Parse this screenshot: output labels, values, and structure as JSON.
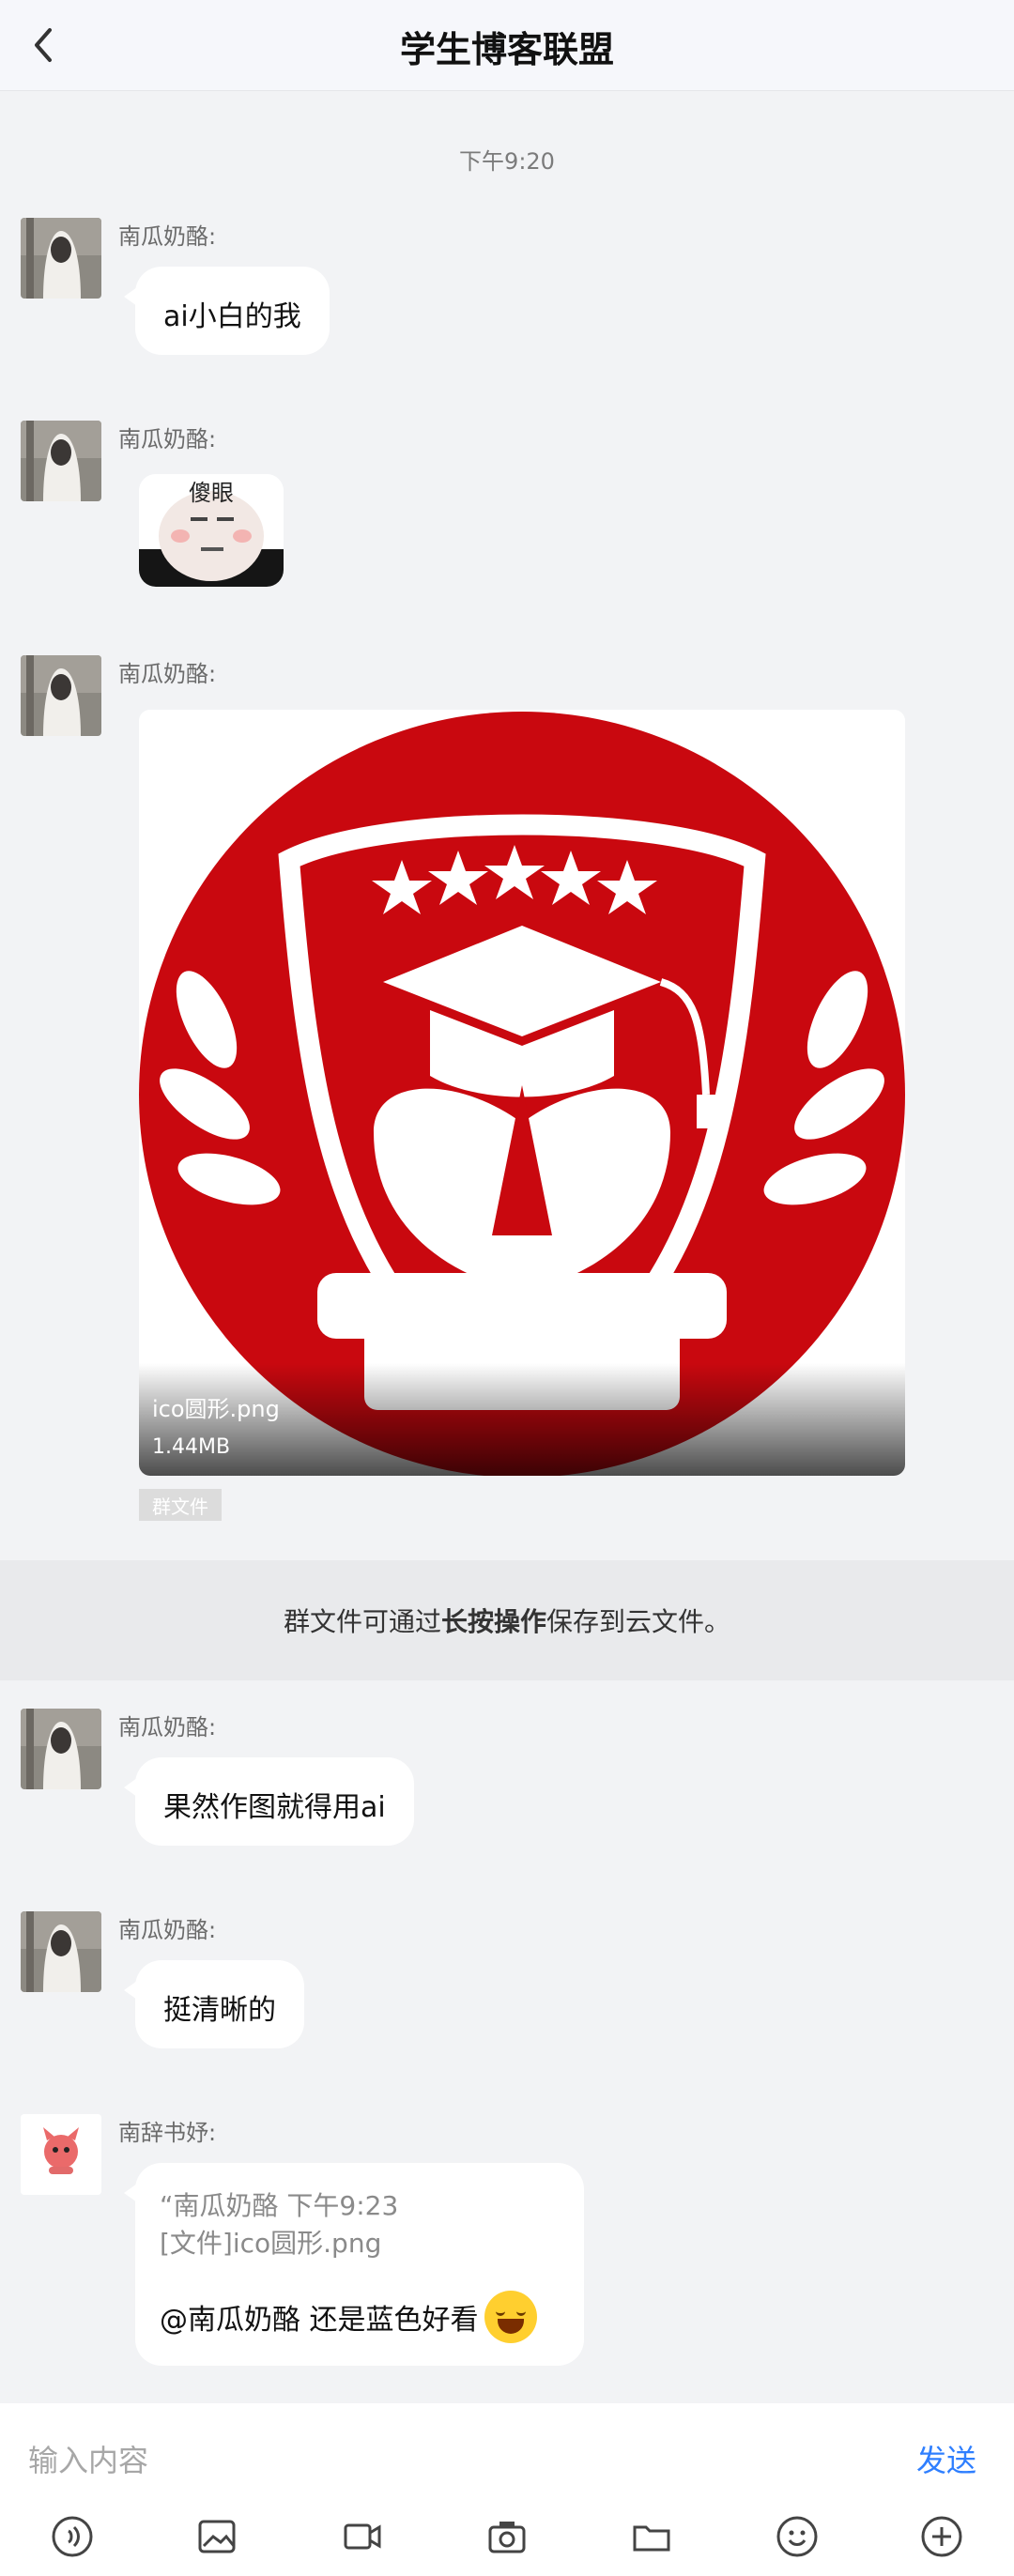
{
  "header": {
    "title": "学生博客联盟"
  },
  "chat": {
    "time_separator": "下午9:20",
    "messages": [
      {
        "sender": "南瓜奶酪:",
        "text": "ai小白的我"
      },
      {
        "sender": "南瓜奶酪:",
        "sticker_text": "傻眼"
      },
      {
        "sender": "南瓜奶酪:",
        "file_name": "ico圆形.png",
        "file_size": "1.44MB",
        "tag": "群文件"
      },
      {
        "sender": "南瓜奶酪:",
        "text": "果然作图就得用ai"
      },
      {
        "sender": "南瓜奶酪:",
        "text": "挺清晰的"
      },
      {
        "sender": "南辞书妤:",
        "quote_line1": "“南瓜奶酪 下午9:23",
        "quote_line2": "[文件]ico圆形.png",
        "reply_text": "@南瓜奶酪 还是蓝色好看"
      }
    ],
    "notice": {
      "prefix": "群文件可通过",
      "bold": "长按操作",
      "suffix": "保存到云文件。"
    }
  },
  "composer": {
    "placeholder": "输入内容",
    "send_label": "发送"
  },
  "toolbar": {
    "icons": [
      "voice-icon",
      "image-icon",
      "video-icon",
      "camera-icon",
      "folder-icon",
      "emoji-icon",
      "plus-icon"
    ]
  },
  "colors": {
    "accent": "#2f7fff",
    "bubble": "#ffffff",
    "logo_red": "#c9080f"
  }
}
